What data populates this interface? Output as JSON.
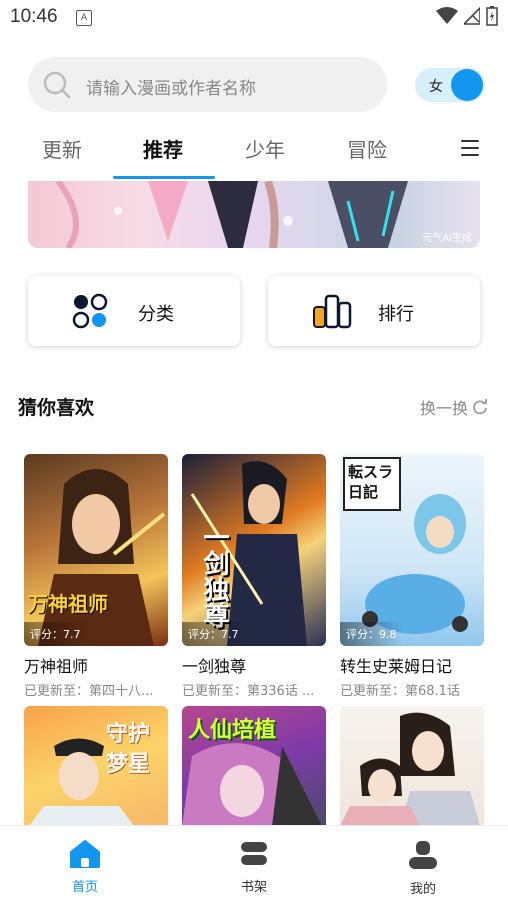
{
  "status": {
    "time": "10:46",
    "notif_letter": "A"
  },
  "search": {
    "placeholder": "请输入漫画或作者名称"
  },
  "gender_toggle": {
    "label": "女"
  },
  "tabs": [
    {
      "label": "更新"
    },
    {
      "label": "推荐",
      "active": true
    },
    {
      "label": "少年"
    },
    {
      "label": "冒险"
    }
  ],
  "banner": {
    "watermark": "元气AI生成"
  },
  "quick": {
    "category_label": "分类",
    "rank_label": "排行"
  },
  "section": {
    "title": "猜你喜欢",
    "refresh_label": "换一换"
  },
  "books": [
    {
      "title": "万神祖师",
      "score": "评分：7.7",
      "update": "已更新至：第四十八...",
      "cover_text": "万神祖师"
    },
    {
      "title": "一剑独尊",
      "score": "评分：7.7",
      "update": "已更新至：第336话 ...",
      "cover_text": "一剑独尊"
    },
    {
      "title": "转生史莱姆日记",
      "score": "评分：9.8",
      "update": "已更新至：第68.1话",
      "cover_text": "転スラ日記"
    },
    {
      "title": "",
      "cover_text": "守护梦星"
    },
    {
      "title": "",
      "cover_text": "人仙培植"
    },
    {
      "title": "",
      "cover_text": ""
    }
  ],
  "bottom_nav": [
    {
      "label": "首页",
      "icon": "home-icon",
      "active": true
    },
    {
      "label": "书架",
      "icon": "bookshelf-icon"
    },
    {
      "label": "我的",
      "icon": "profile-icon"
    }
  ],
  "colors": {
    "accent": "#1296f0"
  }
}
